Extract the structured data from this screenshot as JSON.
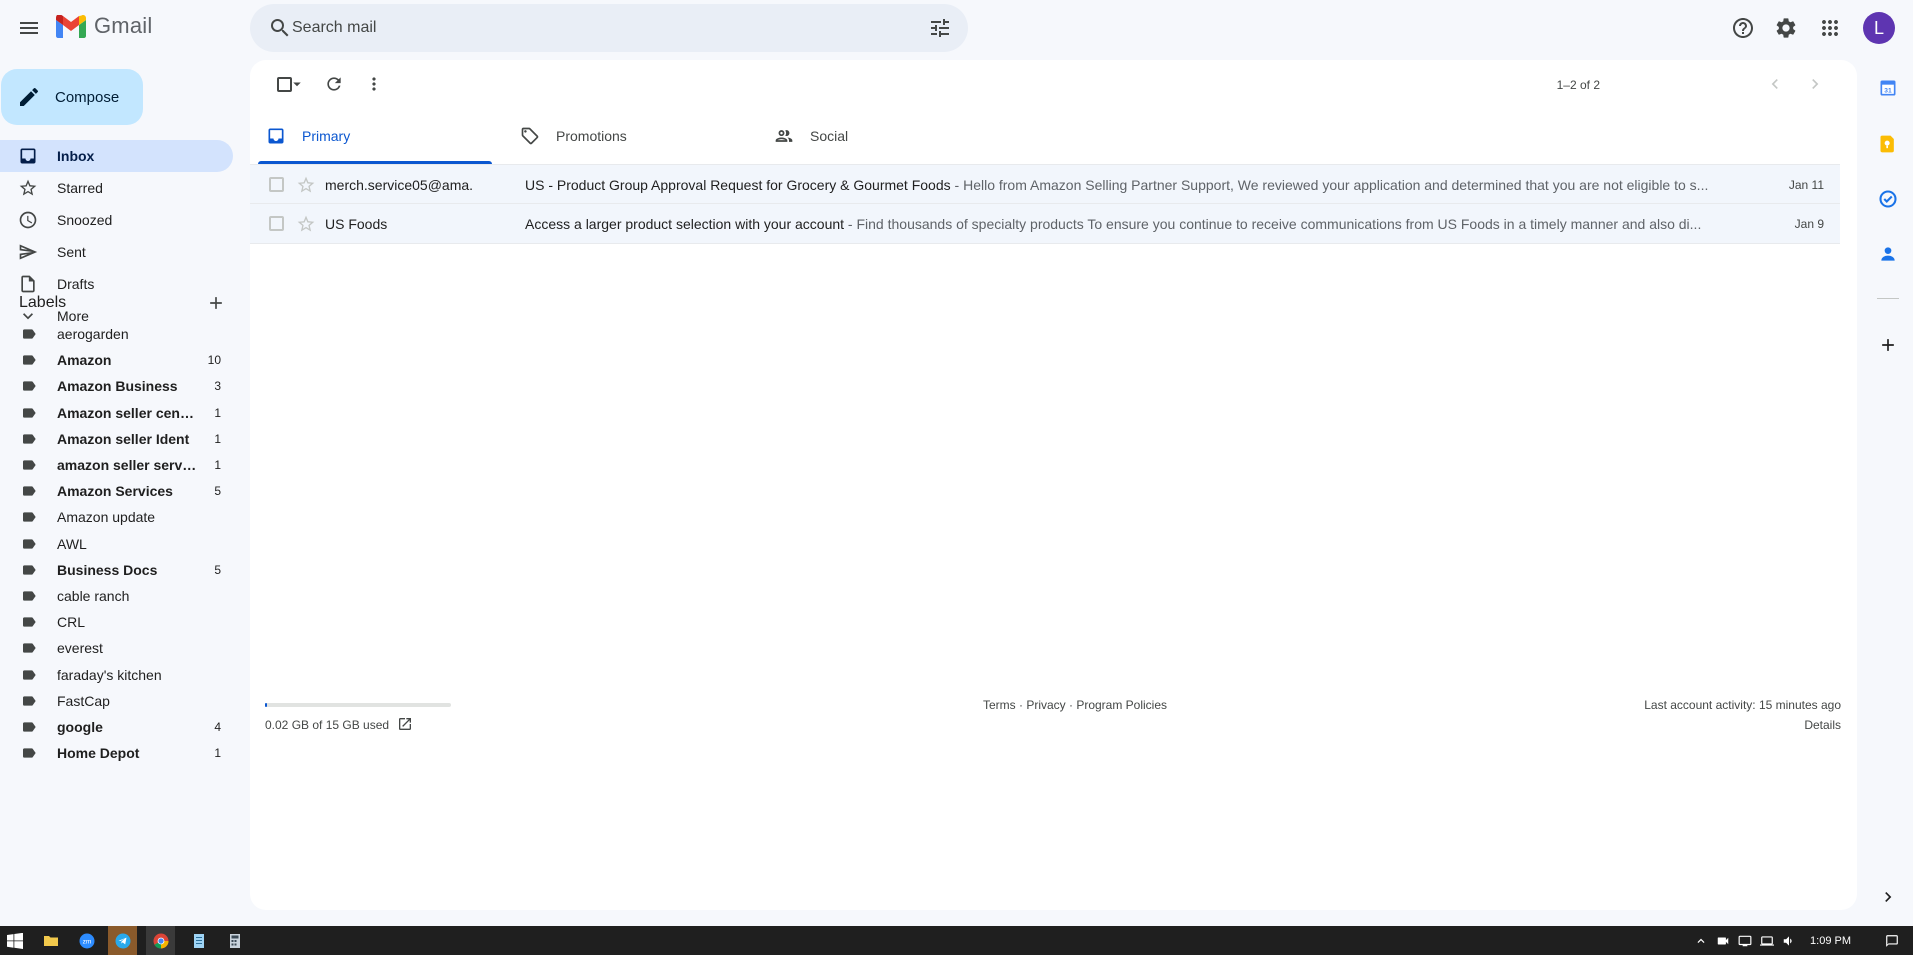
{
  "app": {
    "name": "Gmail",
    "avatar_letter": "L",
    "avatar_color": "#5e35b1"
  },
  "search": {
    "placeholder": "Search mail"
  },
  "compose": {
    "label": "Compose"
  },
  "nav": [
    {
      "label": "Inbox",
      "icon": "inbox-icon",
      "active": true
    },
    {
      "label": "Starred",
      "icon": "star-icon"
    },
    {
      "label": "Snoozed",
      "icon": "clock-icon"
    },
    {
      "label": "Sent",
      "icon": "send-icon"
    },
    {
      "label": "Drafts",
      "icon": "draft-icon"
    },
    {
      "label": "More",
      "icon": "chevron-down-icon"
    }
  ],
  "labels": {
    "heading": "Labels",
    "items": [
      {
        "name": "aerogarden",
        "count": "",
        "bold": false
      },
      {
        "name": "Amazon",
        "count": "10",
        "bold": true
      },
      {
        "name": "Amazon Business",
        "count": "3",
        "bold": true
      },
      {
        "name": "Amazon seller cent…",
        "count": "1",
        "bold": true
      },
      {
        "name": "Amazon seller Ident",
        "count": "1",
        "bold": true
      },
      {
        "name": "amazon seller servi…",
        "count": "1",
        "bold": true
      },
      {
        "name": "Amazon Services",
        "count": "5",
        "bold": true
      },
      {
        "name": "Amazon update",
        "count": "",
        "bold": false
      },
      {
        "name": "AWL",
        "count": "",
        "bold": false
      },
      {
        "name": "Business Docs",
        "count": "5",
        "bold": true
      },
      {
        "name": "cable ranch",
        "count": "",
        "bold": false
      },
      {
        "name": "CRL",
        "count": "",
        "bold": false
      },
      {
        "name": "everest",
        "count": "",
        "bold": false
      },
      {
        "name": "faraday's kitchen",
        "count": "",
        "bold": false
      },
      {
        "name": "FastCap",
        "count": "",
        "bold": false
      },
      {
        "name": "google",
        "count": "4",
        "bold": true
      },
      {
        "name": "Home Depot",
        "count": "1",
        "bold": true
      }
    ]
  },
  "toolbar": {
    "page_count": "1–2 of 2"
  },
  "tabs": [
    {
      "label": "Primary",
      "icon": "inbox-icon",
      "active": true
    },
    {
      "label": "Promotions",
      "icon": "tag-icon"
    },
    {
      "label": "Social",
      "icon": "people-icon"
    }
  ],
  "emails": [
    {
      "sender": "merch.service05@ama.",
      "subject": "US - Product Group Approval Request for Grocery & Gourmet Foods",
      "snippet": " - Hello from Amazon Selling Partner Support, We reviewed your application and determined that you are not eligible to s...",
      "date": "Jan 11"
    },
    {
      "sender": "US Foods",
      "subject": "Access a larger product selection with your account",
      "snippet": " - Find thousands of specialty products To ensure you continue to receive communications from US Foods in a timely manner and also di...",
      "date": "Jan 9"
    }
  ],
  "footer": {
    "storage_text": "0.02 GB of 15 GB used",
    "storage_fraction": 0.0013,
    "terms": "Terms",
    "sep": " · ",
    "privacy": "Privacy",
    "policies": "Program Policies",
    "activity": "Last account activity: 15 minutes ago",
    "details": "Details"
  },
  "taskbar": {
    "time": "1:09 PM"
  }
}
